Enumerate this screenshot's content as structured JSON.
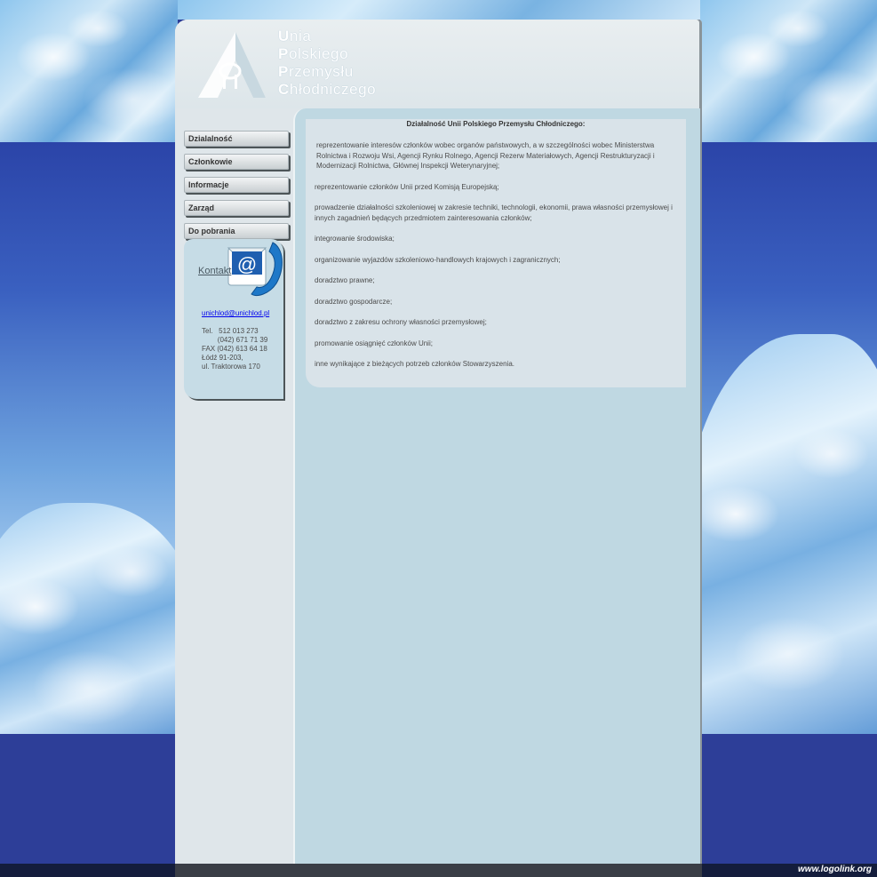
{
  "header": {
    "logo_lines": [
      {
        "cap": "U",
        "rest": "nia"
      },
      {
        "cap": "P",
        "rest": "olskiego"
      },
      {
        "cap": "P",
        "rest": "rzemysłu"
      },
      {
        "cap": "C",
        "rest": "hłodniczego"
      }
    ]
  },
  "nav": {
    "items": [
      {
        "label": "Dzialalność"
      },
      {
        "label": "Członkowie"
      },
      {
        "label": "Informacje"
      },
      {
        "label": "Zarząd"
      },
      {
        "label": "Do pobrania"
      }
    ]
  },
  "contact": {
    "link_label": "Kontakt",
    "icon": "email-phone-icon",
    "email": "unichlod@unichlod.pl",
    "lines": [
      "Tel.   512 013 273",
      "        (042) 671 71 39",
      "FAX (042) 613 64 18",
      "",
      "Łódź 91-203,",
      "ul. Traktorowa 170"
    ]
  },
  "content": {
    "title": "Działalność Unii Polskiego Przemysłu Chłodniczego:",
    "paragraphs": [
      "reprezentowanie interesów członków wobec organów państwowych, a w szczególności wobec Ministerstwa Rolnictwa i Rozwoju Wsi, Agencji Rynku Rolnego, Agencji Rezerw Materiałowych, Agencji Restrukturyzacji i Modernizacji Rolnictwa, Głównej Inspekcji Weterynaryjnej;",
      "reprezentowanie członków Unii przed Komisją Europejską;",
      "prowadzenie działalności szkoleniowej w zakresie techniki, technologii, ekonomii, prawa własności przemysłowej i innych zagadnień będących przedmiotem zainteresowania członków;",
      "integrowanie środowiska;",
      "organizowanie wyjazdów szkoleniowo-handlowych krajowych i zagranicznych;",
      "doradztwo prawne;",
      "doradztwo gospodarcze;",
      "doradztwo z zakresu ochrony własności przemysłowej;",
      "promowanie osiągnięć członków Unii;",
      "inne wynikające z bieżących potrzeb członków Stowarzyszenia."
    ]
  },
  "footer": {
    "credit": "www.logolink.org"
  },
  "colors": {
    "page_bg": "#2a3c96",
    "container_bg": "#dfe6ea",
    "content_bg": "#bfd8e2",
    "content_box_bg": "#d9e3e9",
    "link": "#0000ee"
  }
}
